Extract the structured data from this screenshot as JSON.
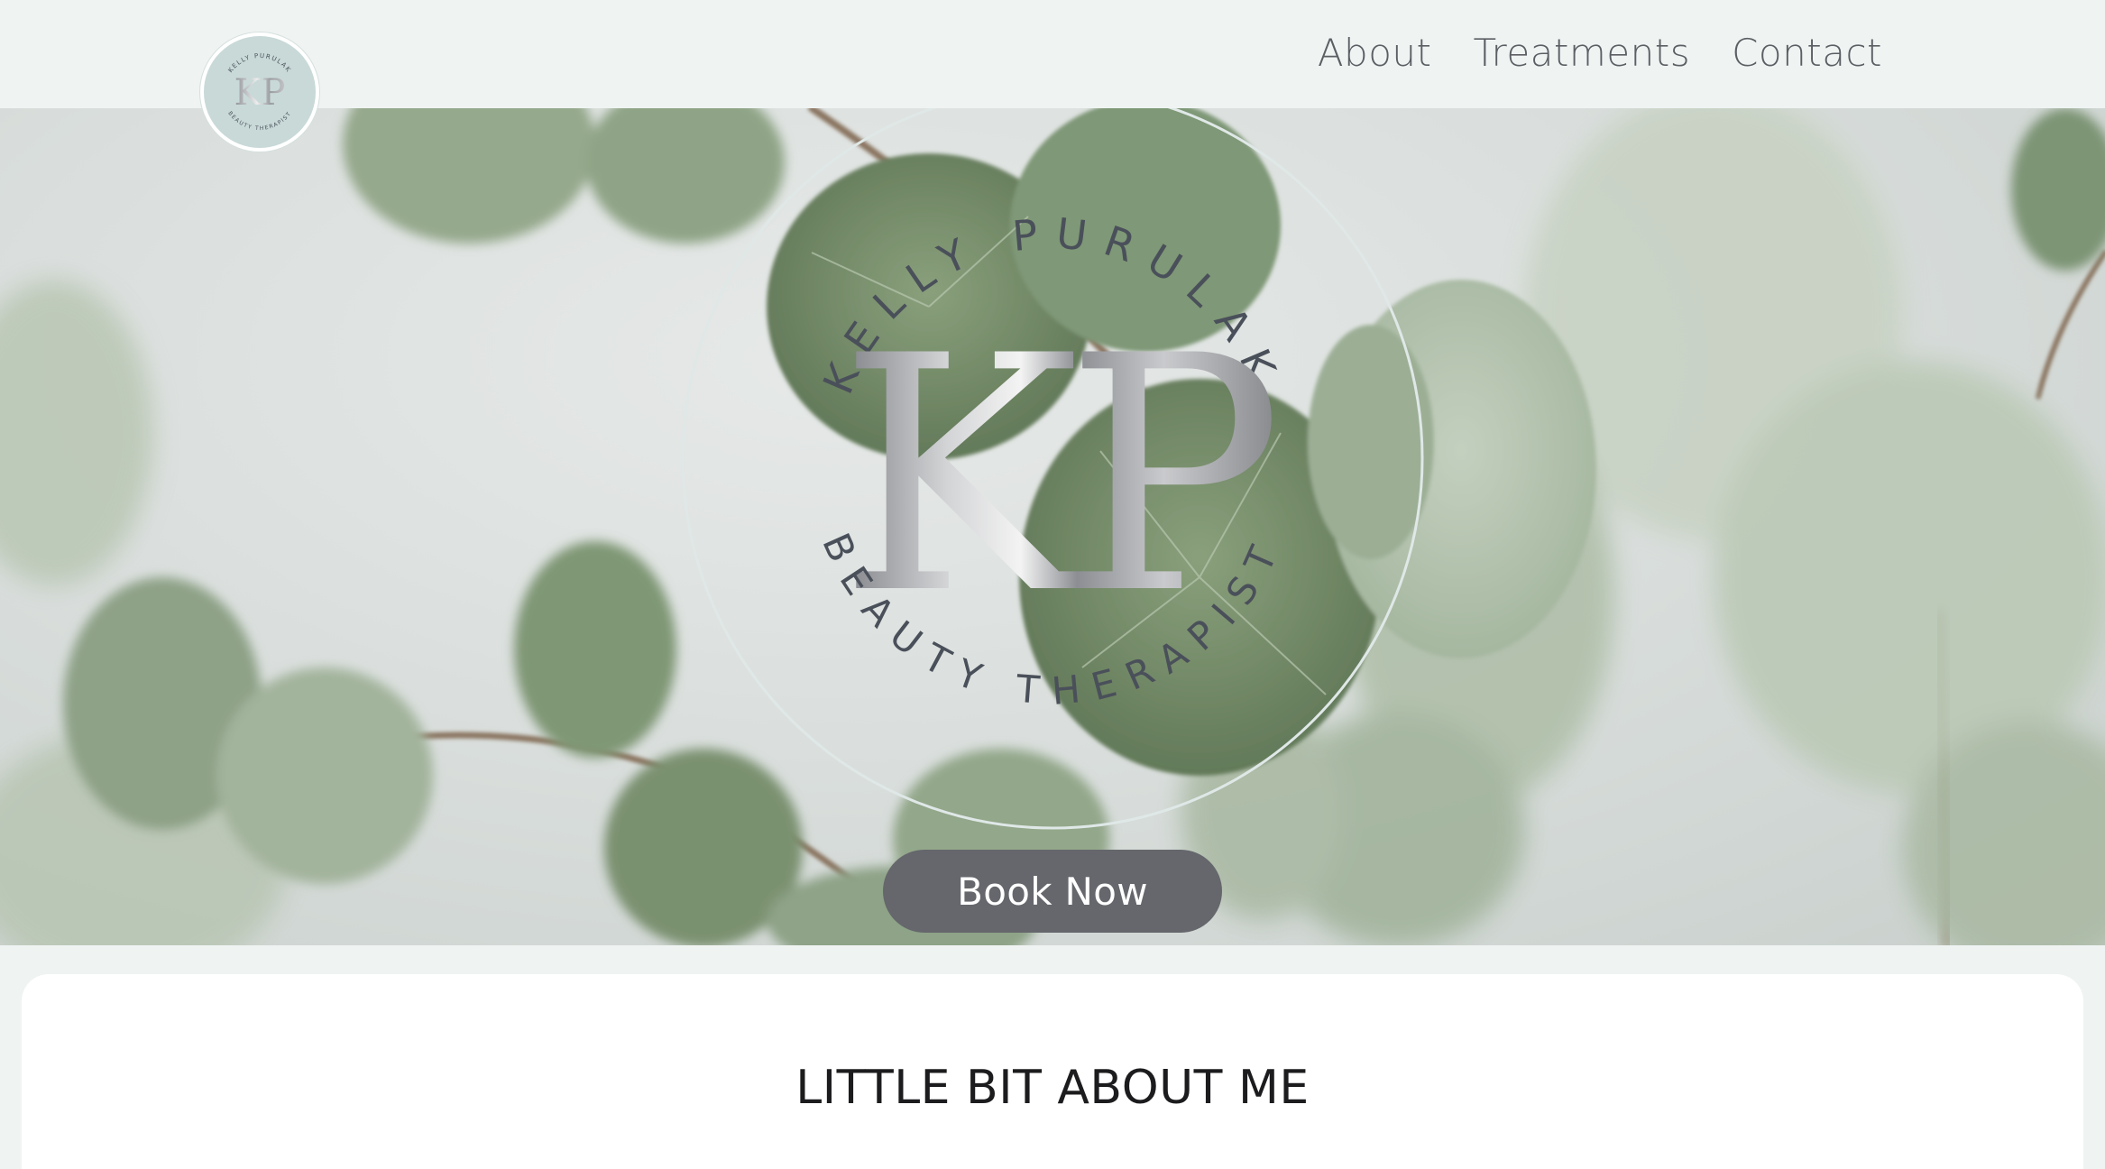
{
  "header": {
    "logo": {
      "monogram": "KP",
      "name": "KELLY PURULAK",
      "tagline": "BEAUTY THERAPIST",
      "icon": "kp-logo-icon"
    },
    "nav": [
      {
        "label": "About"
      },
      {
        "label": "Treatments"
      },
      {
        "label": "Contact"
      }
    ]
  },
  "hero": {
    "background_image": "eucalyptus-leaves-photo",
    "emblem": {
      "top_text": "KELLY PURULAK",
      "monogram": "KP",
      "bottom_text": "BEAUTY THERAPIST"
    },
    "cta_label": "Book Now"
  },
  "about": {
    "title": "LITTLE BIT ABOUT ME"
  },
  "colors": {
    "page_bg": "#eff3f2",
    "nav_text": "#5b5e63",
    "button_bg": "#65676c",
    "button_text": "#ffffff",
    "card_bg": "#ffffff",
    "emblem_text": "#4a505a",
    "logo_circle": "#c8d9d8"
  }
}
